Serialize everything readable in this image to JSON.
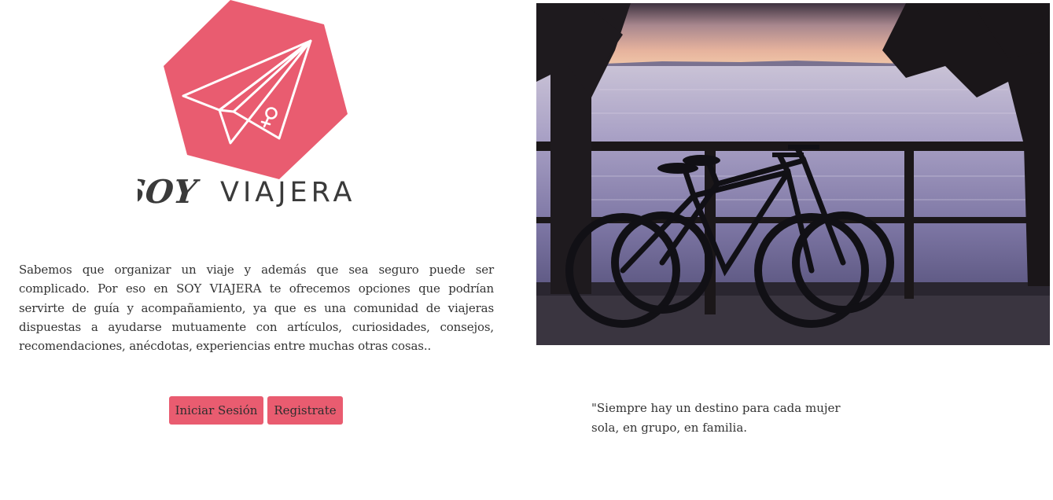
{
  "brand": {
    "soy": "SOY",
    "viajera": "VIAJERA",
    "accent_color": "#e95c70",
    "dark_color": "#3a3a3a",
    "icons": [
      "paper-plane-icon",
      "female-symbol-icon"
    ]
  },
  "intro": {
    "text": "Sabemos que organizar un viaje y además que sea seguro puede ser complicado. Por eso en SOY VIAJERA te ofrecemos opciones que podrían servirte de guía y acompañamiento, ya que es una comunidad de viajeras dispuestas a ayudarse mutuamente con artículos, curiosidades, consejos, recomendaciones, anécdotas, experiencias entre muchas otras cosas.."
  },
  "actions": {
    "login_label": "Iniciar Sesión",
    "register_label": "Registrate"
  },
  "hero": {
    "subject": "bicycles-silhouette-at-sunset-sea"
  },
  "quote": {
    "text": "\"Siempre hay un destino para cada mujer sola, en grupo, en familia."
  }
}
